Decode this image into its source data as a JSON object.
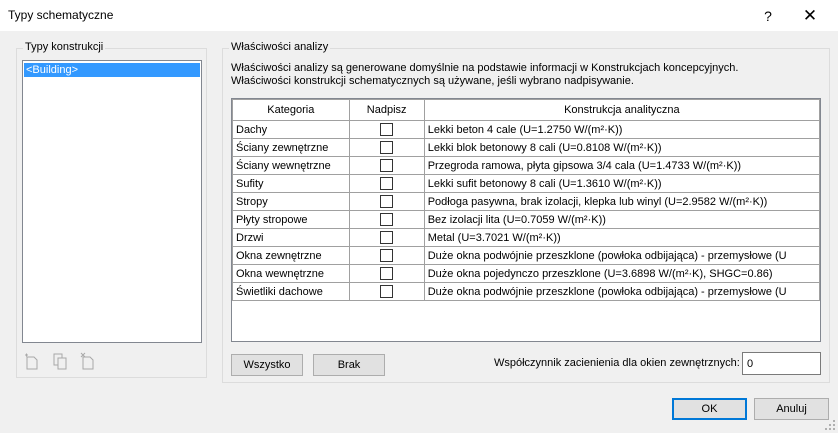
{
  "window": {
    "title": "Typy schematyczne",
    "help_label": "?",
    "close_label": "✕"
  },
  "left_group": {
    "caption": "Typy konstrukcji",
    "items": [
      "<Building>"
    ]
  },
  "right_group": {
    "caption": "Właściwości analizy",
    "description_line1": "Właściwości analizy są generowane domyślnie na podstawie informacji w Konstrukcjach koncepcyjnych.",
    "description_line2": "Właściwości konstrukcji schematycznych są używane, jeśli wybrano nadpisywanie."
  },
  "table": {
    "columns": [
      "Kategoria",
      "Nadpisz",
      "Konstrukcja analityczna"
    ],
    "rows": [
      {
        "category": "Dachy",
        "override": false,
        "construction": "Lekki beton 4 cale (U=1.2750 W/(m²·K))"
      },
      {
        "category": "Ściany zewnętrzne",
        "override": false,
        "construction": "Lekki blok betonowy 8 cali (U=0.8108 W/(m²·K))"
      },
      {
        "category": "Ściany wewnętrzne",
        "override": false,
        "construction": "Przegroda ramowa, płyta gipsowa 3/4 cala (U=1.4733 W/(m²·K))"
      },
      {
        "category": "Sufity",
        "override": false,
        "construction": "Lekki sufit betonowy 8 cali (U=1.3610 W/(m²·K))"
      },
      {
        "category": "Stropy",
        "override": false,
        "construction": "Podłoga pasywna, brak izolacji, klepka lub winyl (U=2.9582 W/(m²·K))"
      },
      {
        "category": "Płyty stropowe",
        "override": false,
        "construction": "Bez izolacji lita (U=0.7059 W/(m²·K))"
      },
      {
        "category": "Drzwi",
        "override": false,
        "construction": "Metal (U=3.7021 W/(m²·K))"
      },
      {
        "category": "Okna zewnętrzne",
        "override": false,
        "construction": "Duże okna podwójnie przeszklone (powłoka odbijająca) - przemysłowe (U"
      },
      {
        "category": "Okna wewnętrzne",
        "override": false,
        "construction": "Duże okna pojedynczo przeszklone (U=3.6898 W/(m²·K), SHGC=0.86)"
      },
      {
        "category": "Świetliki dachowe",
        "override": false,
        "construction": "Duże okna podwójnie przeszklone (powłoka odbijająca) - przemysłowe (U"
      }
    ]
  },
  "buttons": {
    "all_label": "Wszystko",
    "none_label": "Brak",
    "ok_label": "OK",
    "cancel_label": "Anuluj"
  },
  "shading": {
    "label": "Współczynnik zacienienia dla okien zewnętrznych:",
    "value": "0"
  },
  "icons": [
    "new-type-icon",
    "duplicate-type-icon",
    "delete-type-icon",
    "size-grip-icon"
  ],
  "colors": {
    "selection": "#3399ff",
    "default_button_border": "#0078d7"
  }
}
